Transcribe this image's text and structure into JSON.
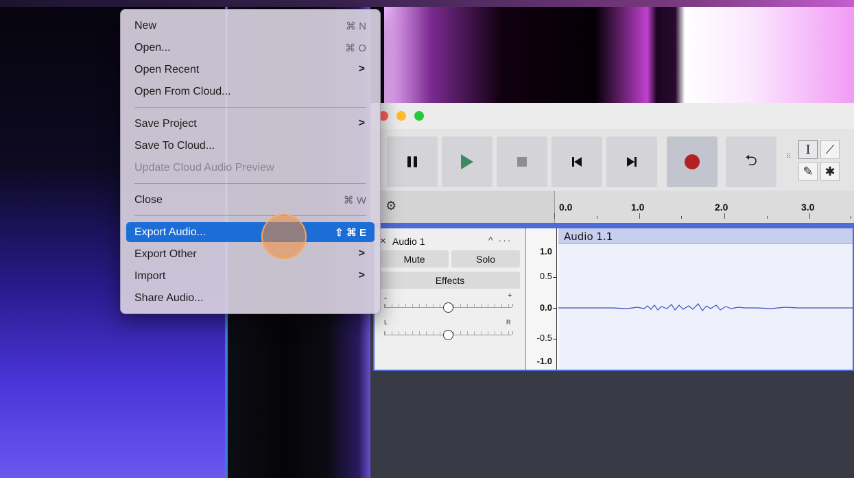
{
  "file_menu": {
    "items": [
      {
        "label": "New",
        "shortcut": "⌘ N"
      },
      {
        "label": "Open...",
        "shortcut": "⌘ O"
      },
      {
        "label": "Open Recent",
        "submenu": ">"
      },
      {
        "label": "Open From Cloud..."
      },
      {
        "label": "Save Project",
        "submenu": ">"
      },
      {
        "label": "Save To Cloud..."
      },
      {
        "label": "Update Cloud Audio Preview",
        "disabled": true
      },
      {
        "label": "Close",
        "shortcut": "⌘ W"
      },
      {
        "label": "Export Audio...",
        "shortcut": "⇧ ⌘ E",
        "highlighted": true
      },
      {
        "label": "Export Other",
        "submenu": ">"
      },
      {
        "label": "Import",
        "submenu": ">"
      },
      {
        "label": "Share Audio..."
      }
    ]
  },
  "toolbar": {
    "pause_icon": "pause-icon",
    "play_icon": "play-icon",
    "stop_icon": "stop-icon",
    "skip_start_icon": "skip-to-start-icon",
    "skip_end_icon": "skip-to-end-icon",
    "record_icon": "record-icon",
    "loop_glyph": "⮌",
    "tools": {
      "select": "I",
      "envelope": "⟋",
      "draw": "✎",
      "multi": "✱"
    }
  },
  "ruler": {
    "gear_glyph": "⚙",
    "ticks": [
      "0.0",
      "1.0",
      "2.0",
      "3.0"
    ]
  },
  "track": {
    "close_glyph": "×",
    "name": "Audio 1",
    "menu_glyph": "^ ···",
    "mute_label": "Mute",
    "solo_label": "Solo",
    "effects_label": "Effects",
    "gain_minus": "-",
    "gain_plus": "+",
    "pan_left": "L",
    "pan_right": "R",
    "scale": [
      "1.0",
      "0.5",
      "0.0",
      "-0.5",
      "-1.0"
    ],
    "clip_name": "Audio 1.1"
  },
  "colors": {
    "menu_highlight": "#1c6dd6",
    "record": "#b22222",
    "play": "#3f8a5a",
    "selection_blue": "#4f6bd8"
  }
}
